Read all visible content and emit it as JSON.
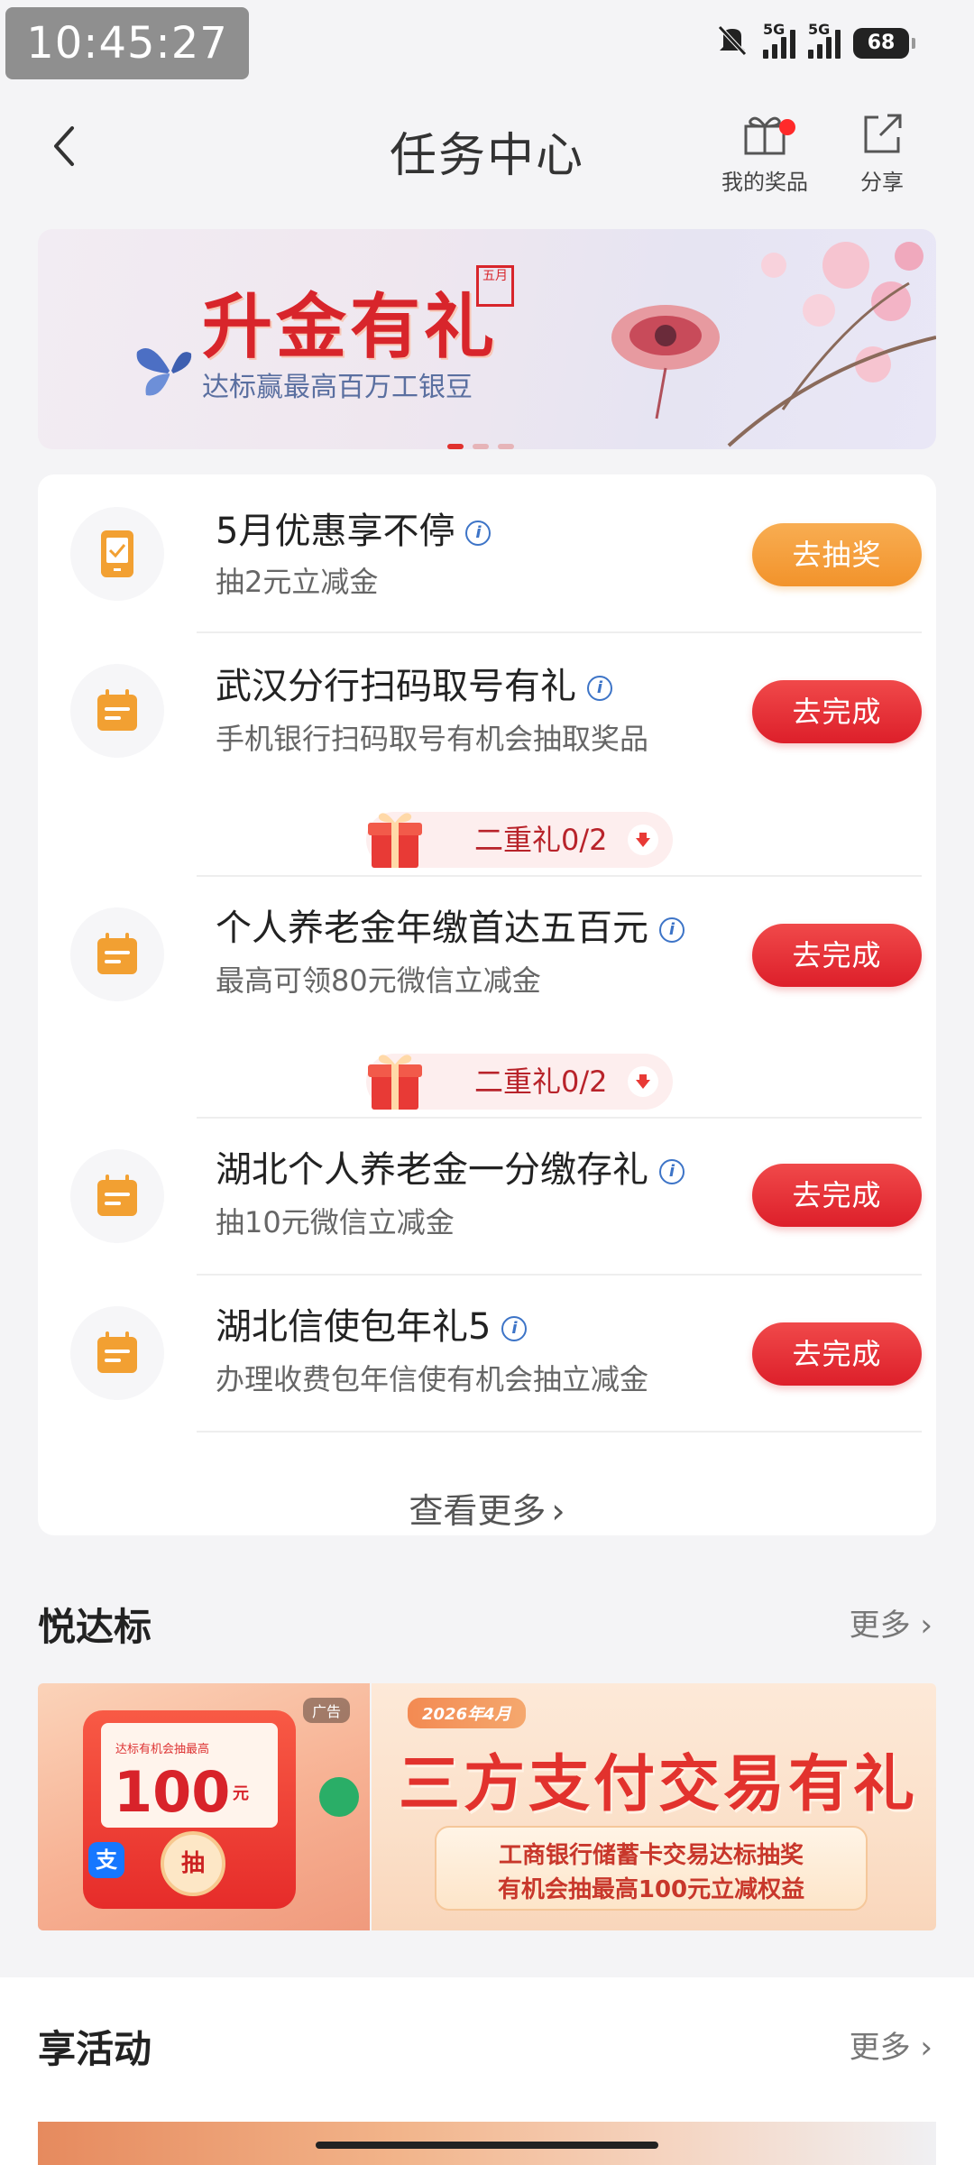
{
  "status_bar": {
    "time": "10:45:27",
    "network_1": "5G",
    "network_2": "5G",
    "battery": "68"
  },
  "header": {
    "title": "任务中心",
    "prizes_label": "我的奖品",
    "share_label": "分享"
  },
  "banner": {
    "title": "升金有礼",
    "subtitle": "达标赢最高百万工银豆",
    "seal": "五月"
  },
  "tasks": [
    {
      "name": "5月优惠享不停",
      "desc": "抽2元立减金",
      "button": "去抽奖",
      "icon": "phone-icon"
    },
    {
      "name": "武汉分行扫码取号有礼",
      "desc": "手机银行扫码取号有机会抽取奖品",
      "button": "去完成",
      "icon": "calendar-icon",
      "gift": "二重礼0/2"
    },
    {
      "name": "个人养老金年缴首达五百元",
      "desc": "最高可领80元微信立减金",
      "button": "去完成",
      "icon": "calendar-icon",
      "gift": "二重礼0/2"
    },
    {
      "name": "湖北个人养老金一分缴存礼",
      "desc": "抽10元微信立减金",
      "button": "去完成",
      "icon": "calendar-icon"
    },
    {
      "name": "湖北信使包年礼5",
      "desc": "办理收费包年信使有机会抽立减金",
      "button": "去完成",
      "icon": "calendar-icon"
    }
  ],
  "more_tasks_label": "查看更多",
  "section_yue": {
    "title": "悦达标",
    "more": "更多"
  },
  "ad_left": {
    "caption": "达标有机会抽最高",
    "amount": "100",
    "unit": "元",
    "draw": "抽",
    "tag": "广告"
  },
  "ad_right": {
    "date": "2026年4月",
    "title": "三方支付交易有礼",
    "line1": "工商银行储蓄卡交易达标抽奖",
    "line2": "有机会抽最高100元立减权益"
  },
  "section_xiang": {
    "title": "享活动",
    "more": "更多"
  },
  "colors": {
    "accent_red": "#dd1f2a",
    "accent_orange": "#f2932b",
    "icon_orange": "#f2a032"
  }
}
